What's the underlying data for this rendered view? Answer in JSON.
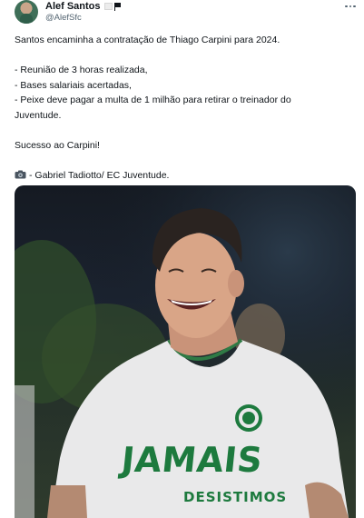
{
  "author": {
    "display_name": "Alef Santos",
    "handle": "@AlefSfc",
    "avatar_icon": "avatar-photo",
    "badge_icon": "flag-icon"
  },
  "tweet": {
    "lines": [
      "Santos encaminha a contratação de Thiago Carpini para 2024.",
      "",
      "- Reunião de 3 horas realizada,",
      "- Bases salariais acertadas,",
      "- Peixe deve pagar a multa de 1 milhão para retirar o treinador do",
      "Juventude.",
      "",
      "Sucesso ao Carpini!",
      "",
      "- Gabriel Tadiotto/ EC Juventude."
    ],
    "credit_icon": "camera-icon"
  },
  "media": {
    "jersey_main": "JAMAIS",
    "jersey_sub": "DESISTIMOS",
    "jersey_color": "#1d7a3e"
  },
  "colors": {
    "text_primary": "#0f1419",
    "text_secondary": "#536471"
  }
}
